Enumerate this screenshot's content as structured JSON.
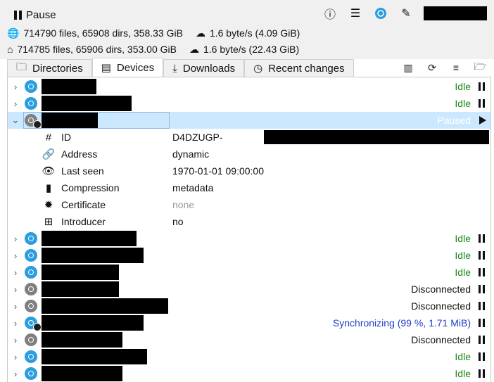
{
  "toolbar": {
    "pause_label": "Pause",
    "icons": [
      "info-icon",
      "menu-icon",
      "syncthing-icon",
      "pin-icon"
    ]
  },
  "stats": {
    "local": "714790 files, 65908 dirs, 358.33 GiB",
    "local_rate": "1.6 byte/s (4.09 GiB)",
    "global": "714785 files, 65906 dirs, 353.00 GiB",
    "global_rate": "1.6 byte/s (22.43 GiB)"
  },
  "tabs": [
    {
      "label": "Directories",
      "icon": "folder-icon"
    },
    {
      "label": "Devices",
      "icon": "devices-icon"
    },
    {
      "label": "Downloads",
      "icon": "download-icon"
    },
    {
      "label": "Recent changes",
      "icon": "clock-icon"
    }
  ],
  "active_tab": "Devices",
  "devices": [
    {
      "status": "Idle",
      "kind": "idle"
    },
    {
      "status": "Idle",
      "kind": "idle"
    },
    {
      "status": "Paused",
      "kind": "paused"
    },
    {
      "status": "Idle",
      "kind": "idle"
    },
    {
      "status": "Idle",
      "kind": "idle"
    },
    {
      "status": "Idle",
      "kind": "idle"
    },
    {
      "status": "Disconnected",
      "kind": "disc"
    },
    {
      "status": "Disconnected",
      "kind": "disc"
    },
    {
      "status": "Synchronizing (99 %, 1.71 MiB)",
      "kind": "sync"
    },
    {
      "status": "Disconnected",
      "kind": "disc"
    },
    {
      "status": "Idle",
      "kind": "idle"
    },
    {
      "status": "Idle",
      "kind": "idle"
    }
  ],
  "details": [
    {
      "label": "ID",
      "value": "D4DZUGP-",
      "icon": "hash-icon"
    },
    {
      "label": "Address",
      "value": "dynamic",
      "icon": "link-icon"
    },
    {
      "label": "Last seen",
      "value": "1970-01-01 09:00:00",
      "icon": "eye-icon"
    },
    {
      "label": "Compression",
      "value": "metadata",
      "icon": "zip-icon"
    },
    {
      "label": "Certificate",
      "value": "none",
      "icon": "certificate-icon"
    },
    {
      "label": "Introducer",
      "value": "no",
      "icon": "network-icon"
    }
  ],
  "colors": {
    "idle": "#1a8a1a",
    "sync": "#2040c8",
    "selected_bg": "#cce8ff",
    "accent": "#2b9de0"
  }
}
